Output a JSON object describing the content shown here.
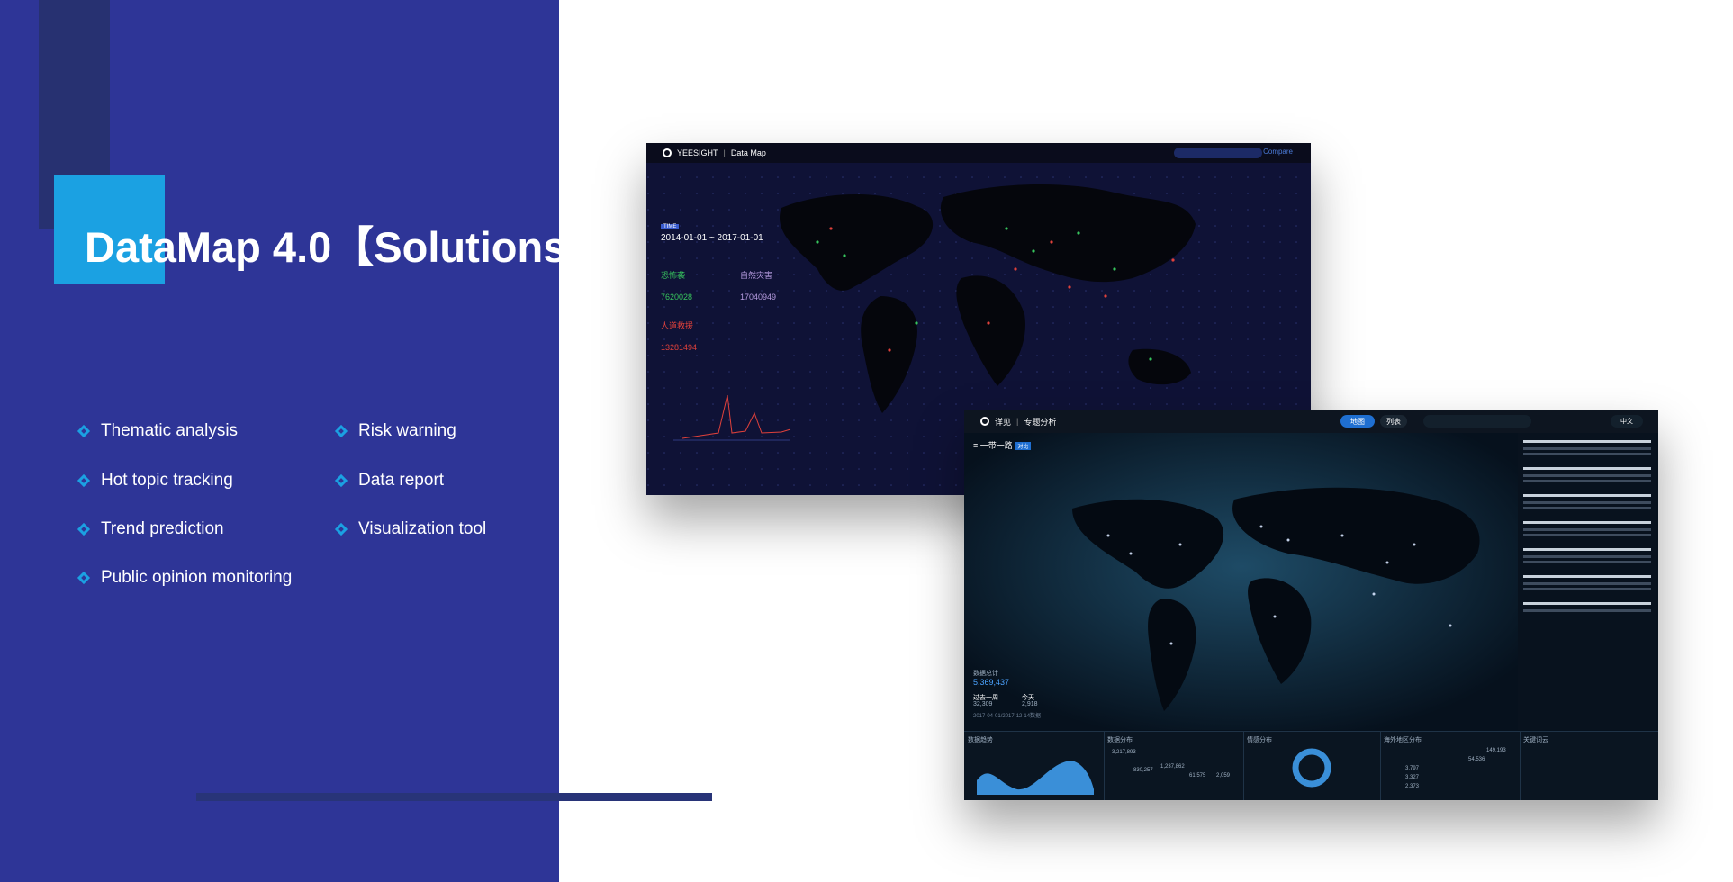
{
  "slide": {
    "title": "DataMap 4.0【Solutions】",
    "accent_color": "#1ba1e2",
    "panel_color": "#2e3597",
    "features_left": [
      "Thematic analysis",
      "Hot topic tracking",
      "Trend prediction",
      "Public opinion monitoring"
    ],
    "features_right": [
      "Risk warning",
      "Data report",
      "Visualization tool"
    ]
  },
  "screenshot1": {
    "brand": "YEESIGHT",
    "module": "Data Map",
    "compare": "Compare",
    "time_label": "TIME",
    "date_range": "2014-01-01 ~ 2017-01-01",
    "stats": [
      {
        "label": "恐怖袭",
        "value": "7620028",
        "color": "#37c45d"
      },
      {
        "label": "自然灾害",
        "value": "17040949",
        "color": "#b69ce0"
      },
      {
        "label": "人道救援",
        "value": "13281494",
        "color": "#e0413b"
      }
    ]
  },
  "screenshot2": {
    "brand": "详见",
    "module": "专题分析",
    "topic": "一带一路",
    "topic_badge": "对比",
    "tab_map": "地图",
    "tab_list": "列表",
    "lang": "中文",
    "total_label": "数据总计",
    "total_value": "5,369,437",
    "week_label": "过去一周",
    "week_value": "32,309",
    "today_label": "今天",
    "today_value": "2,918",
    "date_span": "2017-04-01/2017-12-14数据",
    "bottom_panels": [
      "数据趋势",
      "数据分布",
      "情感分布",
      "海外地区分布",
      "关键词云"
    ],
    "bar_values": [
      "3,217,893",
      "830,257",
      "1,237,862",
      "61,575",
      "2,059"
    ],
    "country_values": [
      "149,193",
      "54,536",
      "3,797",
      "3,327",
      "2,373"
    ]
  }
}
